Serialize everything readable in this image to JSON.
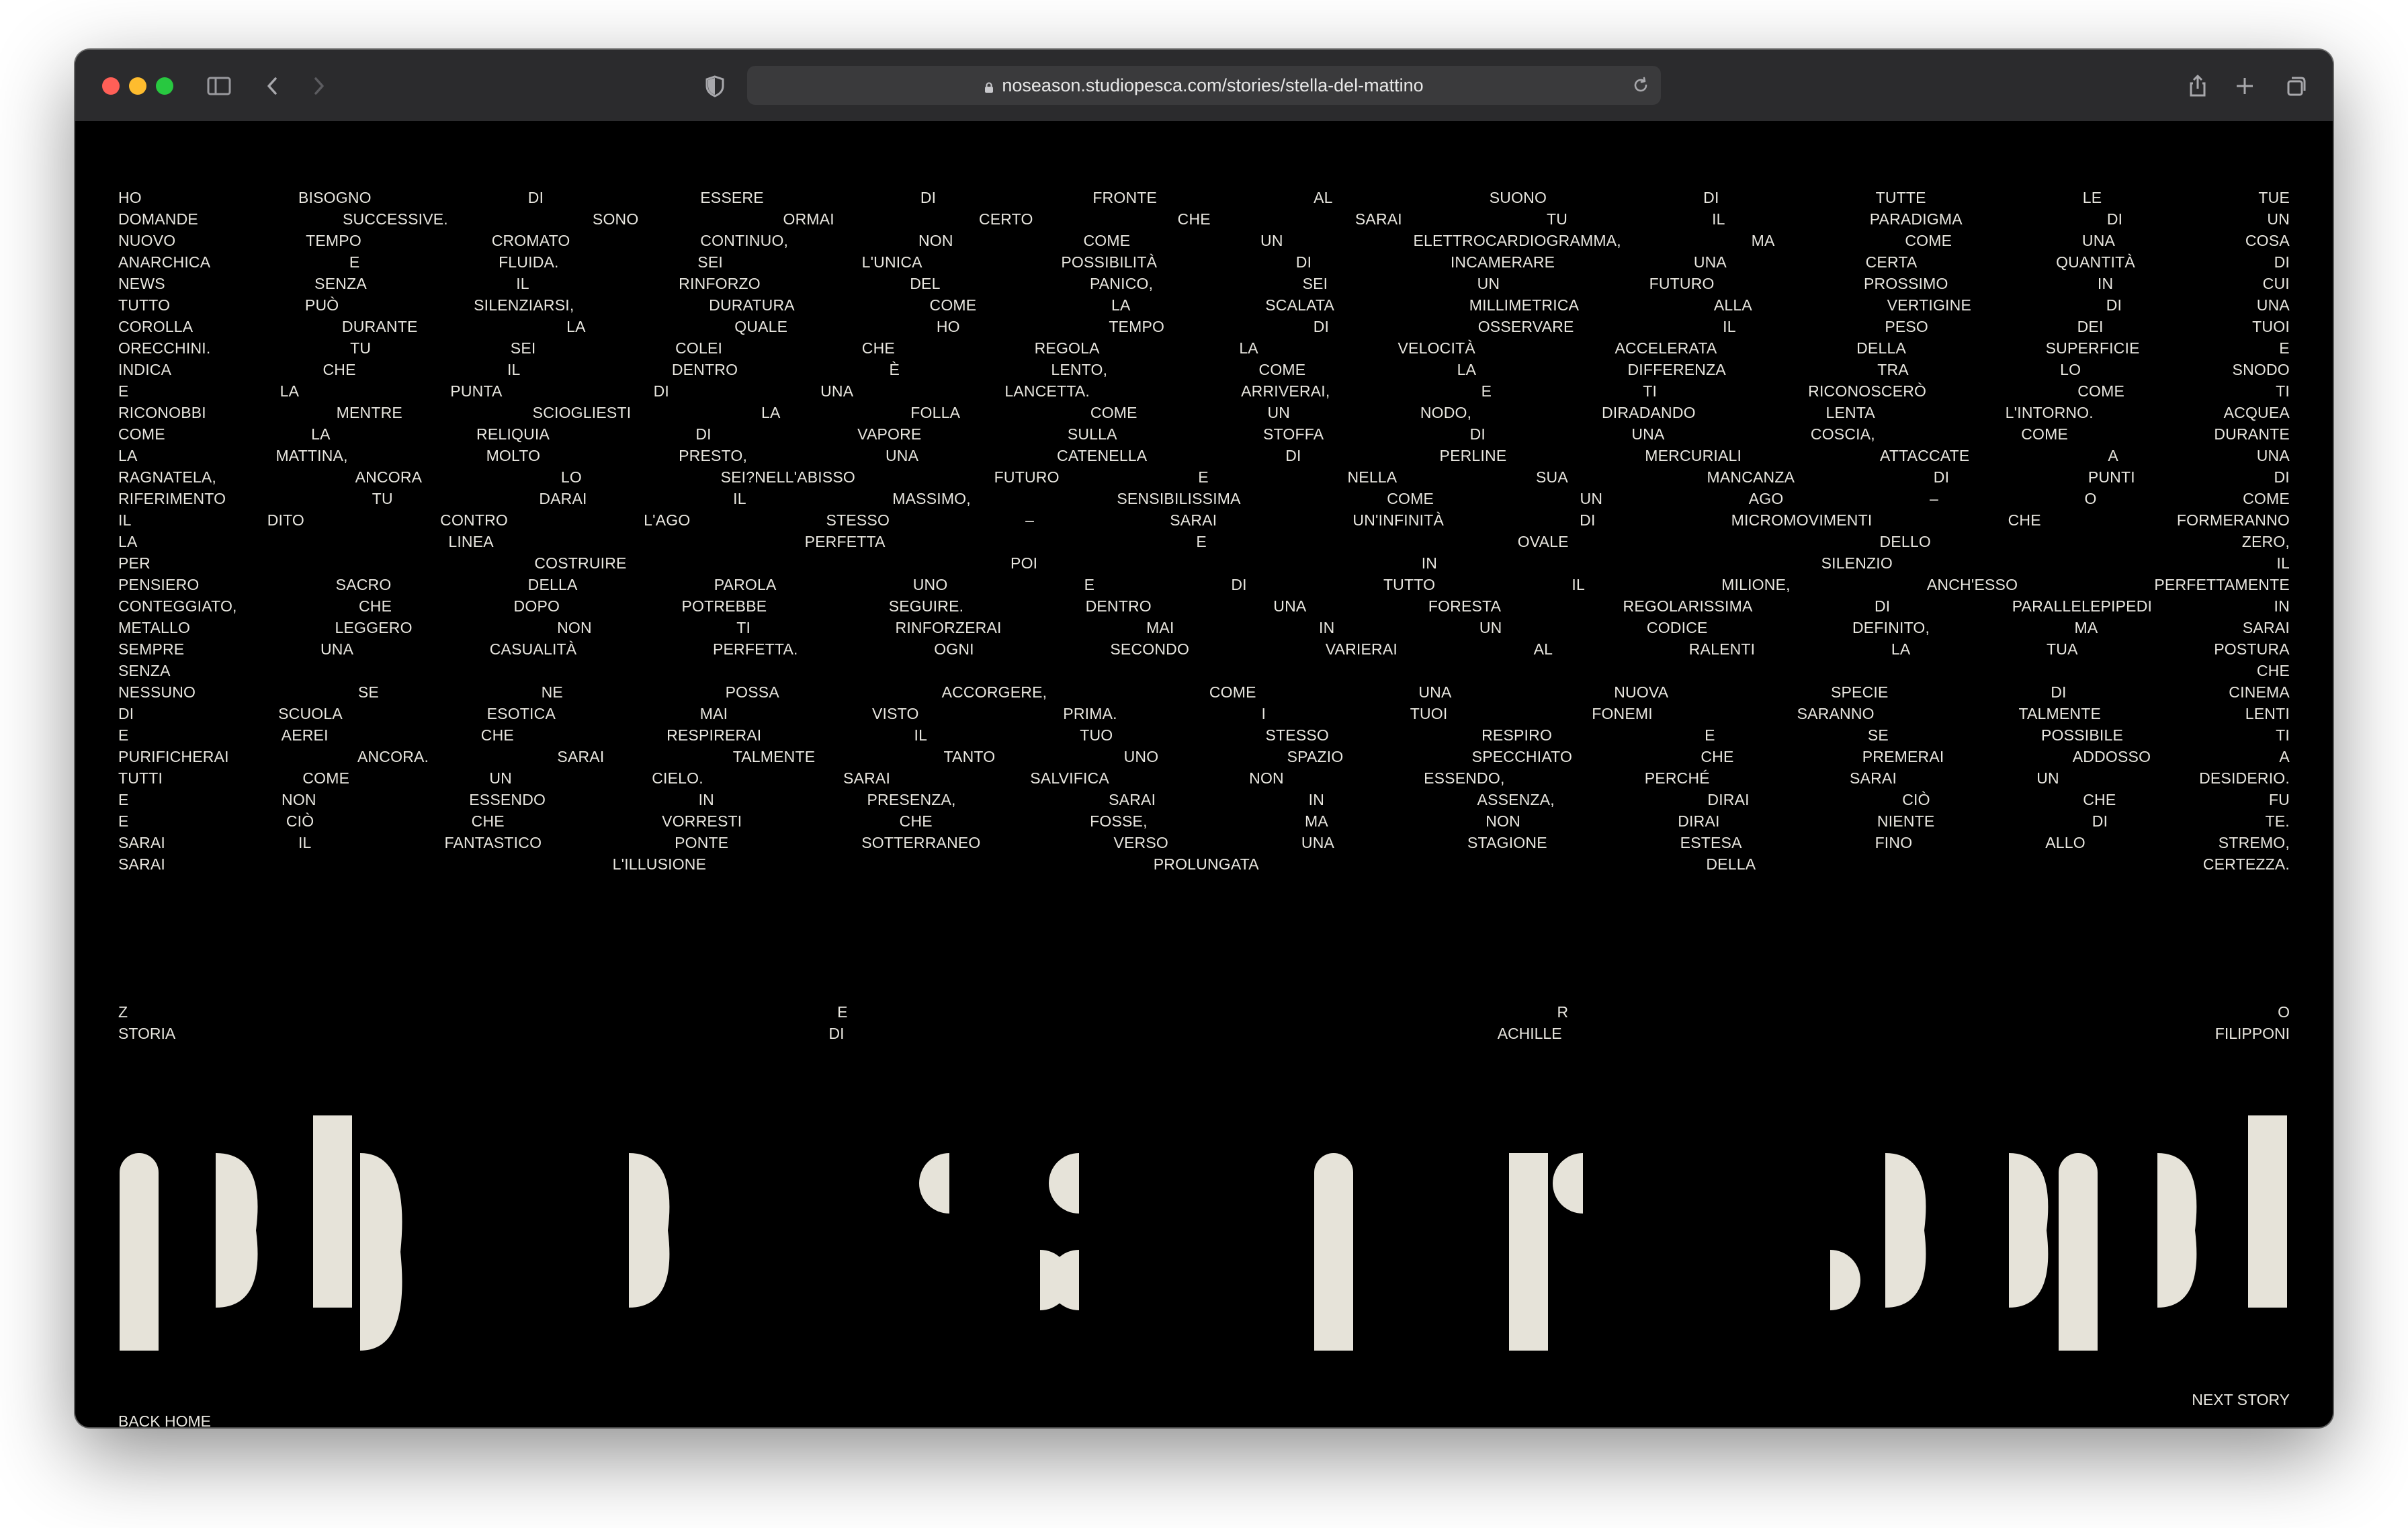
{
  "browser": {
    "url": "noseason.studiopesca.com/stories/stella-del-mattino"
  },
  "poem": [
    [
      "HO",
      "BISOGNO",
      "DI",
      "ESSERE",
      "DI",
      "FRONTE",
      "AL",
      "SUONO",
      "DI",
      "TUTTE",
      "LE",
      "TUE"
    ],
    [
      "DOMANDE",
      "SUCCESSIVE.",
      "SONO",
      "ORMAI",
      "CERTO",
      "CHE",
      "SARAI",
      "TU",
      "IL",
      "PARADIGMA",
      "DI",
      "UN"
    ],
    [
      "NUOVO",
      "TEMPO",
      "CROMATO",
      "CONTINUO,",
      "NON",
      "COME",
      "UN",
      "ELETTROCARDIOGRAMMA,",
      "MA",
      "COME",
      "UNA",
      "COSA"
    ],
    [
      "ANARCHICA",
      "E",
      "FLUIDA.",
      "SEI",
      "L'UNICA",
      "POSSIBILITÀ",
      "DI",
      "INCAMERARE",
      "UNA",
      "CERTA",
      "QUANTITÀ",
      "DI"
    ],
    [
      "NEWS",
      "SENZA",
      "IL",
      "RINFORZO",
      "DEL",
      "PANICO,",
      "SEI",
      "UN",
      "FUTURO",
      "PROSSIMO",
      "IN",
      "CUI"
    ],
    [
      "TUTTO",
      "PUÒ",
      "SILENZIARSI,",
      "DURATURA",
      "COME",
      "LA",
      "SCALATA",
      "MILLIMETRICA",
      "ALLA",
      "VERTIGINE",
      "DI",
      "UNA"
    ],
    [
      "COROLLA",
      "DURANTE",
      "LA",
      "QUALE",
      "HO",
      "TEMPO",
      "DI",
      "OSSERVARE",
      "IL",
      "PESO",
      "DEI",
      "TUOI"
    ],
    [
      "ORECCHINI.",
      "TU",
      "SEI",
      "COLEI",
      "CHE",
      "REGOLA",
      "LA",
      "VELOCITÀ",
      "ACCELERATA",
      "DELLA",
      "SUPERFICIE",
      "E"
    ],
    [
      "INDICA",
      "CHE",
      "IL",
      "DENTRO",
      "È",
      "LENTO,",
      "COME",
      "LA",
      "DIFFERENZA",
      "TRA",
      "LO",
      "SNODO"
    ],
    [
      "E",
      "LA",
      "PUNTA",
      "DI",
      "UNA",
      "LANCETTA.",
      "ARRIVERAI,",
      "E",
      "TI",
      "RICONOSCERÒ",
      "COME",
      "TI"
    ],
    [
      "RICONOBBI",
      "MENTRE",
      "SCIOGLIESTI",
      "LA",
      "FOLLA",
      "COME",
      "UN",
      "NODO,",
      "DIRADANDO",
      "LENTA",
      "L'INTORNO.",
      "ACQUEA"
    ],
    [
      "COME",
      "LA",
      "RELIQUIA",
      "DI",
      "VAPORE",
      "SULLA",
      "STOFFA",
      "DI",
      "UNA",
      "COSCIA,",
      "COME",
      "DURANTE"
    ],
    [
      "LA",
      "MATTINA,",
      "MOLTO",
      "PRESTO,",
      "UNA",
      "CATENELLA",
      "DI",
      "PERLINE",
      "MERCURIALI",
      "ATTACCATE",
      "A",
      "UNA"
    ],
    [
      "RAGNATELA,",
      "ANCORA",
      "LO",
      "SEI?NELL'ABISSO",
      "FUTURO",
      "E",
      "NELLA",
      "SUA",
      "MANCANZA",
      "DI",
      "PUNTI",
      "DI"
    ],
    [
      "RIFERIMENTO",
      "TU",
      "DARAI",
      "IL",
      "MASSIMO,",
      "SENSIBILISSIMA",
      "COME",
      "UN",
      "AGO",
      "–",
      "O",
      "COME"
    ],
    [
      "IL",
      "DITO",
      "CONTRO",
      "L'AGO",
      "STESSO",
      "–",
      "SARAI",
      "UN'INFINITÀ",
      "DI",
      "MICROMOVIMENTI",
      "CHE",
      "FORMERANNO"
    ],
    [
      "LA",
      "LINEA",
      "PERFETTA",
      "E",
      "OVALE",
      "DELLO",
      "ZERO,"
    ],
    [
      "PER",
      "COSTRUIRE",
      "POI",
      "IN",
      "SILENZIO",
      "IL"
    ],
    [
      "PENSIERO",
      "SACRO",
      "DELLA",
      "PAROLA",
      "UNO",
      "E",
      "DI",
      "TUTTO",
      "IL",
      "MILIONE,",
      "ANCH'ESSO",
      "PERFETTAMENTE"
    ],
    [
      "CONTEGGIATO,",
      "CHE",
      "DOPO",
      "POTREBBE",
      "SEGUIRE.",
      "DENTRO",
      "UNA",
      "FORESTA",
      "REGOLARISSIMA",
      "DI",
      "PARALLELEPIPEDI",
      "IN"
    ],
    [
      "METALLO",
      "LEGGERO",
      "NON",
      "TI",
      "RINFORZERAI",
      "MAI",
      "IN",
      "UN",
      "CODICE",
      "DEFINITO,",
      "MA",
      "SARAI"
    ],
    [
      "SEMPRE",
      "UNA",
      "CASUALITÀ",
      "PERFETTA.",
      "OGNI",
      "SECONDO",
      "VARIERAI",
      "AL",
      "RALENTI",
      "LA",
      "TUA",
      "POSTURA"
    ],
    [
      "SENZA",
      "CHE"
    ],
    [
      "NESSUNO",
      "SE",
      "NE",
      "POSSA",
      "ACCORGERE,",
      "COME",
      "UNA",
      "NUOVA",
      "SPECIE",
      "DI",
      "CINEMA"
    ],
    [
      "DI",
      "SCUOLA",
      "ESOTICA",
      "MAI",
      "VISTO",
      "PRIMA.",
      "I",
      "TUOI",
      "FONEMI",
      "SARANNO",
      "TALMENTE",
      "LENTI"
    ],
    [
      "E",
      "AEREI",
      "CHE",
      "RESPIRERAI",
      "IL",
      "TUO",
      "STESSO",
      "RESPIRO",
      "E",
      "SE",
      "POSSIBILE",
      "TI"
    ],
    [
      "PURIFICHERAI",
      "ANCORA.",
      "SARAI",
      "TALMENTE",
      "TANTO",
      "UNO",
      "SPAZIO",
      "SPECCHIATO",
      "CHE",
      "PREMERAI",
      "ADDOSSO",
      "A"
    ],
    [
      "TUTTI",
      "COME",
      "UN",
      "CIELO.",
      "SARAI",
      "SALVIFICA",
      "NON",
      "ESSENDO,",
      "PERCHÉ",
      "SARAI",
      "UN",
      "DESIDERIO."
    ],
    [
      "E",
      "NON",
      "ESSENDO",
      "IN",
      "PRESENZA,",
      "SARAI",
      "IN",
      "ASSENZA,",
      "DIRAI",
      "CIÒ",
      "CHE",
      "FU"
    ],
    [
      "E",
      "CIÒ",
      "CHE",
      "VORRESTI",
      "CHE",
      "FOSSE,",
      "MA",
      "NON",
      "DIRAI",
      "NIENTE",
      "DI",
      "TE."
    ],
    [
      "SARAI",
      "IL",
      "FANTASTICO",
      "PONTE",
      "SOTTERRANEO",
      "VERSO",
      "UNA",
      "STAGIONE",
      "ESTESA",
      "FINO",
      "ALLO",
      "STREMO,"
    ],
    [
      "SARAI",
      "L'ILLUSIONE",
      "PROLUNGATA",
      "DELLA",
      "CERTEZZA."
    ]
  ],
  "credits": {
    "row1": [
      "Z",
      "E",
      "R",
      "O"
    ],
    "row2": [
      "STORIA",
      "DI",
      "ACHILLE",
      "FILIPPONI"
    ]
  },
  "glyph_color": "#e6e3d9",
  "nav": {
    "back_home": "BACK HOME",
    "next_story": "NEXT STORY"
  }
}
